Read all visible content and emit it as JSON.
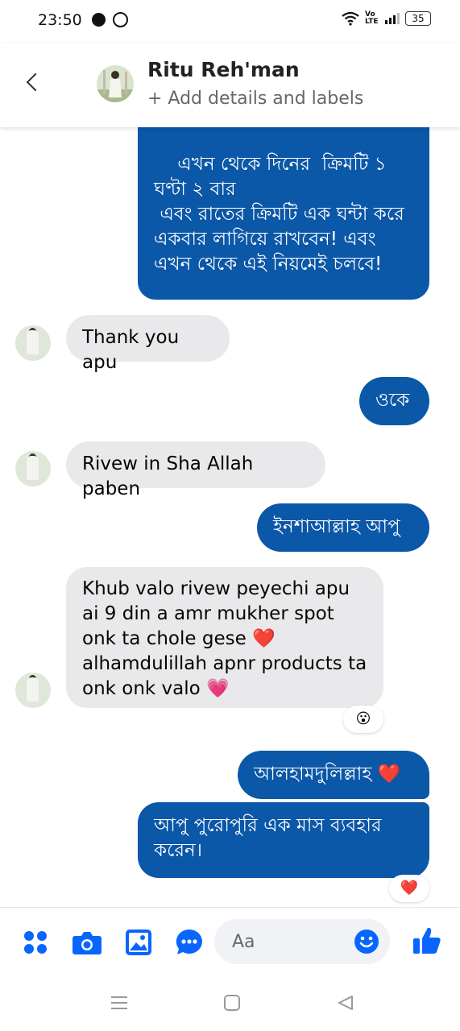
{
  "status_bar": {
    "time": "23:50",
    "network_label": "Vo LTE",
    "battery": "35"
  },
  "header": {
    "contact_name": "Ritu Reh'man",
    "subtitle": "+ Add details and labels"
  },
  "messages": [
    {
      "direction": "out",
      "text": "এখন থেকে দিনের  ক্রিমটি ১ ঘণ্টা ২ বার\n এবং রাতের ক্রিমটি এক ঘন্টা করে একবার লাগিয়ে রাখবেন! এবং এখন থেকে এই নিয়মেই চলবে!"
    },
    {
      "direction": "in",
      "text": "Thank you apu"
    },
    {
      "direction": "out",
      "text": "ওকে"
    },
    {
      "direction": "in",
      "text": "Rivew in Sha Allah paben"
    },
    {
      "direction": "out",
      "text": "ইনশাআল্লাহ আপু"
    },
    {
      "direction": "in",
      "text": "Khub valo rivew peyechi apu ai 9 din a amr mukher spot onk ta chole gese ❤️ alhamdulillah apnr products ta onk onk valo 💗",
      "reaction": "😮"
    },
    {
      "direction": "out",
      "text": "আলহামদুলিল্লাহ ❤️"
    },
    {
      "direction": "out",
      "text": "আপু পুরোপুরি এক মাস ব্যবহার করেন।",
      "reaction": "❤️"
    }
  ],
  "composer": {
    "placeholder": "Aa",
    "icons": [
      "menu-dots-icon",
      "camera-icon",
      "gallery-icon",
      "more-icon",
      "emoji-icon",
      "like-icon"
    ]
  },
  "colors": {
    "outgoing_bubble": "#0b57a8",
    "incoming_bubble": "#e9e9eb",
    "accent": "#0866ff"
  }
}
